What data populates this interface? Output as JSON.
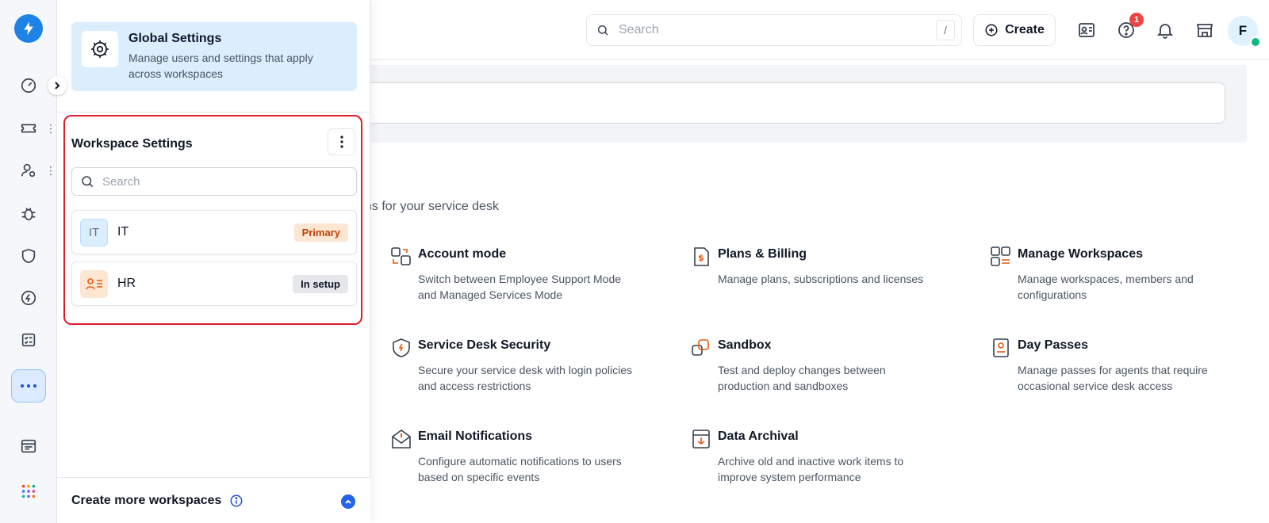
{
  "header": {
    "search_placeholder": "Search",
    "search_shortcut": "/",
    "create_label": "Create",
    "help_badge_count": "1",
    "avatar_initial": "F"
  },
  "settings_panel": {
    "global": {
      "title": "Global Settings",
      "description": "Manage users and settings that apply across workspaces"
    },
    "workspace": {
      "title": "Workspace Settings",
      "search_placeholder": "Search",
      "items": [
        {
          "icon_text": "IT",
          "name": "IT",
          "tag": "Primary"
        },
        {
          "icon_text": "",
          "name": "HR",
          "tag": "In setup"
        }
      ]
    },
    "footer": {
      "label": "Create more workspaces"
    }
  },
  "main": {
    "subtitle_fragment": "ns for your service desk",
    "cards": [
      {
        "icon": "account-mode-icon",
        "title": "Account mode",
        "description": "Switch between Employee Support Mode and Managed Services Mode"
      },
      {
        "icon": "billing-icon",
        "title": "Plans & Billing",
        "description": "Manage plans, subscriptions and licenses"
      },
      {
        "icon": "workspaces-icon",
        "title": "Manage Workspaces",
        "description": "Manage workspaces, members and configurations"
      },
      {
        "icon": "shield-icon",
        "title": "Service Desk Security",
        "description": "Secure your service desk with login policies and access restrictions"
      },
      {
        "icon": "sandbox-icon",
        "title": "Sandbox",
        "description": "Test and deploy changes between production and sandboxes"
      },
      {
        "icon": "day-pass-icon",
        "title": "Day Passes",
        "description": "Manage passes for agents that require occasional service desk access"
      },
      {
        "icon": "email-icon",
        "title": "Email Notifications",
        "description": "Configure automatic notifications to users based on specific events"
      },
      {
        "icon": "archive-icon",
        "title": "Data Archival",
        "description": "Archive old and inactive work items to improve system performance"
      }
    ]
  },
  "colors": {
    "brand": "#1d83e6",
    "accent_orange": "#ea580c",
    "highlight_red": "#e11d2b",
    "primary_tag_bg": "#fde6d2",
    "setup_tag_bg": "#e5e7eb"
  }
}
